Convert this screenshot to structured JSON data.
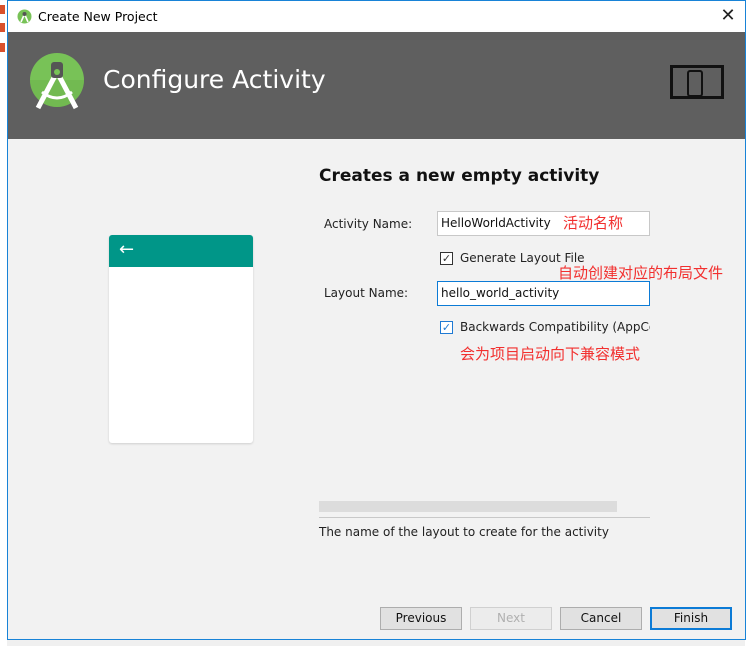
{
  "window": {
    "title": "Create New Project",
    "close_icon": "close-icon"
  },
  "header": {
    "title": "Configure Activity",
    "logo": "android-studio-logo",
    "device_icon": "tablet-phone-icon"
  },
  "preview": {
    "back_icon": "arrow-left-icon",
    "toolbar_color": "#009688"
  },
  "form": {
    "heading": "Creates a new empty activity",
    "activity_name_label": "Activity Name:",
    "activity_name_value": "HelloWorldActivity",
    "generate_layout_label": "Generate Layout File",
    "generate_layout_checked": true,
    "layout_name_label": "Layout Name:",
    "layout_name_value": "hello_world_activity",
    "backwards_label": "Backwards Compatibility (AppCo",
    "backwards_checked": true
  },
  "annotations": {
    "activity_name": "活动名称",
    "layout_file": "自动创建对应的布局文件",
    "compat": "会为项目启动向下兼容模式"
  },
  "description": "The name of the layout to create for the activity",
  "buttons": {
    "previous": "Previous",
    "next": "Next",
    "cancel": "Cancel",
    "finish": "Finish"
  }
}
